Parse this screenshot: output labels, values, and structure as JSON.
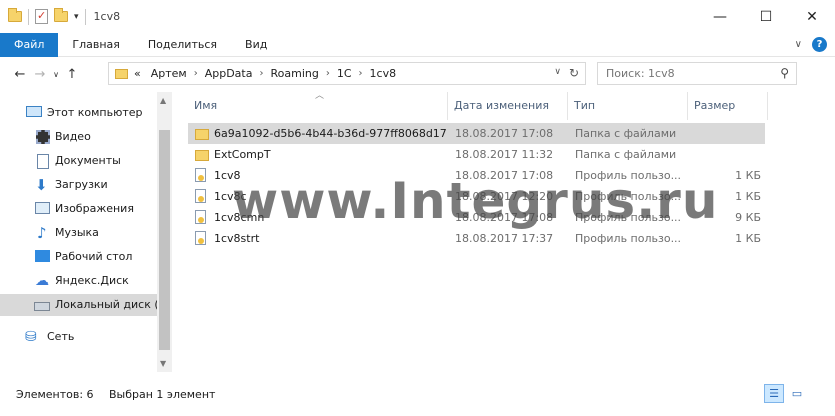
{
  "window": {
    "title": "1cv8",
    "controls": {
      "minimize": "—",
      "maximize": "☐",
      "close": "✕"
    }
  },
  "ribbon": {
    "tabs": [
      "Файл",
      "Главная",
      "Поделиться",
      "Вид"
    ]
  },
  "address": {
    "overflow": "«",
    "crumbs": [
      "Артем",
      "AppData",
      "Roaming",
      "1C",
      "1cv8"
    ],
    "search_placeholder": "Поиск: 1cv8"
  },
  "nav": {
    "items": [
      {
        "label": "Этот компьютер",
        "icon": "pc-icon"
      },
      {
        "label": "Видео",
        "icon": "video-icon"
      },
      {
        "label": "Документы",
        "icon": "documents-icon"
      },
      {
        "label": "Загрузки",
        "icon": "downloads-icon"
      },
      {
        "label": "Изображения",
        "icon": "pictures-icon"
      },
      {
        "label": "Музыка",
        "icon": "music-icon"
      },
      {
        "label": "Рабочий стол",
        "icon": "desktop-icon"
      },
      {
        "label": "Яндекс.Диск",
        "icon": "yandex-disk-icon"
      },
      {
        "label": "Локальный диск (С",
        "icon": "local-disk-icon"
      },
      {
        "label": "Сеть",
        "icon": "network-icon"
      }
    ],
    "selected_index": 8
  },
  "columns": {
    "name": "Имя",
    "date": "Дата изменения",
    "type": "Тип",
    "size": "Размер"
  },
  "files": [
    {
      "name": "6a9a1092-d5b6-4b44-b36d-977ff8068d17",
      "date": "18.08.2017 17:08",
      "type": "Папка с файлами",
      "size": "",
      "kind": "folder"
    },
    {
      "name": "ExtCompT",
      "date": "18.08.2017 11:32",
      "type": "Папка с файлами",
      "size": "",
      "kind": "folder"
    },
    {
      "name": "1cv8",
      "date": "18.08.2017 17:08",
      "type": "Профиль пользо...",
      "size": "1 КБ",
      "kind": "profile"
    },
    {
      "name": "1cv8c",
      "date": "18.08.2017 12:20",
      "type": "Профиль пользо...",
      "size": "1 КБ",
      "kind": "profile"
    },
    {
      "name": "1cv8cmn",
      "date": "18.08.2017 17:08",
      "type": "Профиль пользо...",
      "size": "9 КБ",
      "kind": "profile"
    },
    {
      "name": "1cv8strt",
      "date": "18.08.2017 17:37",
      "type": "Профиль пользо...",
      "size": "1 КБ",
      "kind": "profile"
    }
  ],
  "selected_file_index": 0,
  "watermark": "www.Integrus.ru",
  "status": {
    "count": "Элементов: 6",
    "selection": "Выбран 1 элемент"
  }
}
